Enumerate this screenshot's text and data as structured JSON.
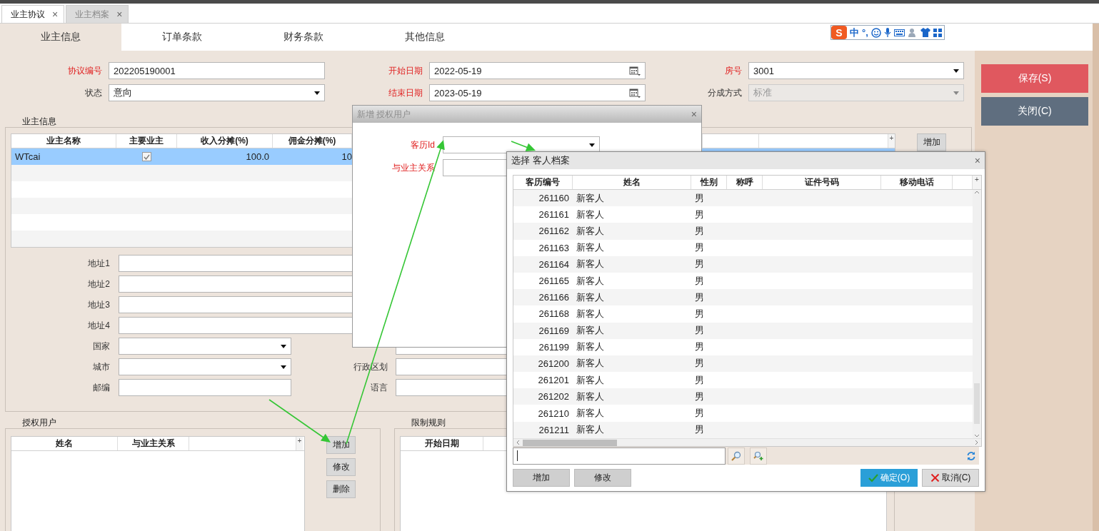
{
  "document_tabs": [
    {
      "label": "业主协议",
      "selected": true,
      "close": "×"
    },
    {
      "label": "业主档案",
      "selected": false,
      "close": "×"
    }
  ],
  "ime_toolbar": {
    "logo": "S",
    "mode": "中",
    "punctuation": "°,"
  },
  "section_tabs": [
    {
      "label": "业主信息",
      "selected": true
    },
    {
      "label": "订单条款",
      "selected": false
    },
    {
      "label": "财务条款",
      "selected": false
    },
    {
      "label": "其他信息",
      "selected": false
    }
  ],
  "header_fields": [
    {
      "label": "协议编号",
      "required": true,
      "kind": "text",
      "value": "202205190001",
      "disabled": false
    },
    {
      "label": "开始日期",
      "required": true,
      "kind": "date",
      "value": "2022-05-19",
      "disabled": false
    },
    {
      "label": "房号",
      "required": true,
      "kind": "dropdown",
      "value": "3001",
      "disabled": false
    },
    {
      "label": "状态",
      "required": false,
      "kind": "dropdown",
      "value": "意向",
      "disabled": false
    },
    {
      "label": "结束日期",
      "required": true,
      "kind": "date",
      "value": "2023-05-19",
      "disabled": false
    },
    {
      "label": "分成方式",
      "required": false,
      "kind": "dropdown",
      "value": "标准",
      "disabled": true
    }
  ],
  "side_buttons": [
    {
      "label": "保存(S)",
      "kind": "save"
    },
    {
      "label": "关闭(C)",
      "kind": "close"
    }
  ],
  "owner_info": {
    "title": "业主信息",
    "columns": [
      "业主名称",
      "主要业主",
      "收入分摊(%)",
      "佣金分摊(%)"
    ],
    "column_chooser": "+",
    "rows": [
      {
        "name": "WTcai",
        "primary_owner": true,
        "income_share": "100.0",
        "commission_share": "10",
        "selected": true
      }
    ],
    "add_button": "增加",
    "address_fields": [
      {
        "label": "地址1"
      },
      {
        "label": "地址2"
      },
      {
        "label": "地址3"
      },
      {
        "label": "地址4"
      }
    ],
    "detail_fields": [
      {
        "label": "国家",
        "kind": "dropdown"
      },
      {
        "label": "城市",
        "kind": "dropdown"
      },
      {
        "label": "邮编",
        "kind": "text"
      }
    ],
    "region_fields": [
      {
        "label": "行政区划"
      },
      {
        "label": "语言"
      }
    ]
  },
  "authorized_users": {
    "title": "授权用户",
    "columns": [
      "姓名",
      "与业主关系"
    ],
    "column_chooser": "+",
    "buttons": [
      "增加",
      "修改",
      "删除"
    ]
  },
  "restriction_rules": {
    "title": "限制规则",
    "columns": [
      "开始日期"
    ]
  },
  "add_user_dialog": {
    "title": "新增 授权用户",
    "close": "×",
    "fields": [
      {
        "label": "客历Id",
        "required": true,
        "kind": "dropdown"
      },
      {
        "label": "与业主关系",
        "required": true,
        "kind": "text"
      }
    ]
  },
  "guest_dialog": {
    "title": "选择 客人档案",
    "close": "×",
    "columns": [
      "客历编号",
      "姓名",
      "性别",
      "称呼",
      "证件号码",
      "移动电话"
    ],
    "column_chooser": "+",
    "rows": [
      {
        "id": "261160",
        "name": "新客人",
        "gender": "男",
        "selected": false
      },
      {
        "id": "261161",
        "name": "新客人",
        "gender": "男",
        "selected": false
      },
      {
        "id": "261162",
        "name": "新客人",
        "gender": "男",
        "selected": false
      },
      {
        "id": "261163",
        "name": "新客人",
        "gender": "男",
        "selected": false
      },
      {
        "id": "261164",
        "name": "新客人",
        "gender": "男",
        "selected": false
      },
      {
        "id": "261165",
        "name": "新客人",
        "gender": "男",
        "selected": false
      },
      {
        "id": "261166",
        "name": "新客人",
        "gender": "男",
        "selected": false
      },
      {
        "id": "261168",
        "name": "新客人",
        "gender": "男",
        "selected": false
      },
      {
        "id": "261169",
        "name": "新客人",
        "gender": "男",
        "selected": false
      },
      {
        "id": "261199",
        "name": "新客人",
        "gender": "男",
        "selected": false
      },
      {
        "id": "261200",
        "name": "新客人",
        "gender": "男",
        "selected": false
      },
      {
        "id": "261201",
        "name": "新客人",
        "gender": "男",
        "selected": false
      },
      {
        "id": "261202",
        "name": "新客人",
        "gender": "男",
        "selected": false
      },
      {
        "id": "261210",
        "name": "新客人",
        "gender": "男",
        "selected": false
      },
      {
        "id": "261211",
        "name": "新客人",
        "gender": "男",
        "selected": false
      }
    ],
    "buttons": [
      {
        "label": "增加",
        "kind": "plain"
      },
      {
        "label": "修改",
        "kind": "plain"
      },
      {
        "label": "确定(O)",
        "kind": "ok"
      },
      {
        "label": "取消(C)",
        "kind": "cancel"
      }
    ]
  }
}
